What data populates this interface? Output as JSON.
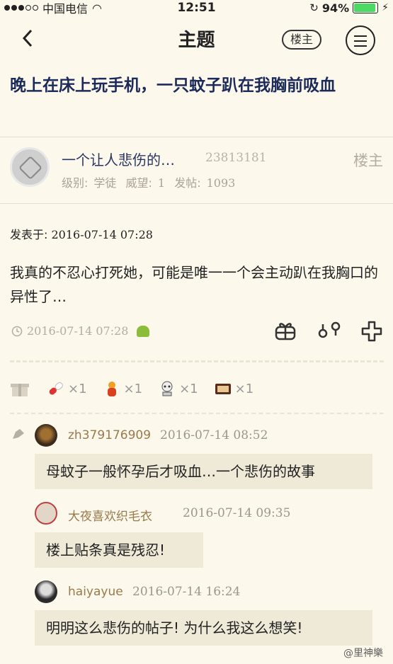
{
  "status_bar": {
    "carrier": "中国电信",
    "time": "12:51",
    "battery": "94%",
    "battery_level": 0.94
  },
  "nav": {
    "title": "主题",
    "louzhu_label": "楼主"
  },
  "post": {
    "title": "晚上在床上玩手机，一只蚊子趴在我胸前吸血",
    "author": {
      "name": "一个让人悲伤的…",
      "id": "23813181",
      "tag": "楼主",
      "level_label": "级别:",
      "level": "学徒",
      "prestige_label": "威望:",
      "prestige": "1",
      "posts_label": "发帖:",
      "posts": "1093"
    },
    "date_label": "发表于:",
    "date": "2016-07-14 07:28",
    "body": "我真的不忍心打死她，可能是唯一一个会主动趴在我胸口的异性了…",
    "footer_time": "2016-07-14 07:28"
  },
  "gifts": [
    {
      "icon": "pill-icon",
      "count": "×1"
    },
    {
      "icon": "fire-figure-icon",
      "count": "×1"
    },
    {
      "icon": "skull-icon",
      "count": "×1"
    },
    {
      "icon": "box-icon",
      "count": "×1"
    }
  ],
  "comments": [
    {
      "user": "zh379176909",
      "time": "2016-07-14 08:52",
      "text": "母蚊子一般怀孕后才吸血…一个悲伤的故事"
    },
    {
      "user": "大夜喜欢织毛衣",
      "time": "2016-07-14 09:35",
      "text": "楼上贴条真是残忍!"
    },
    {
      "user": "haiyayue",
      "time": "2016-07-14 16:24",
      "text": "明明这么悲伤的帖子! 为什么我这么想笑!"
    }
  ],
  "watermark": "@里神樂"
}
